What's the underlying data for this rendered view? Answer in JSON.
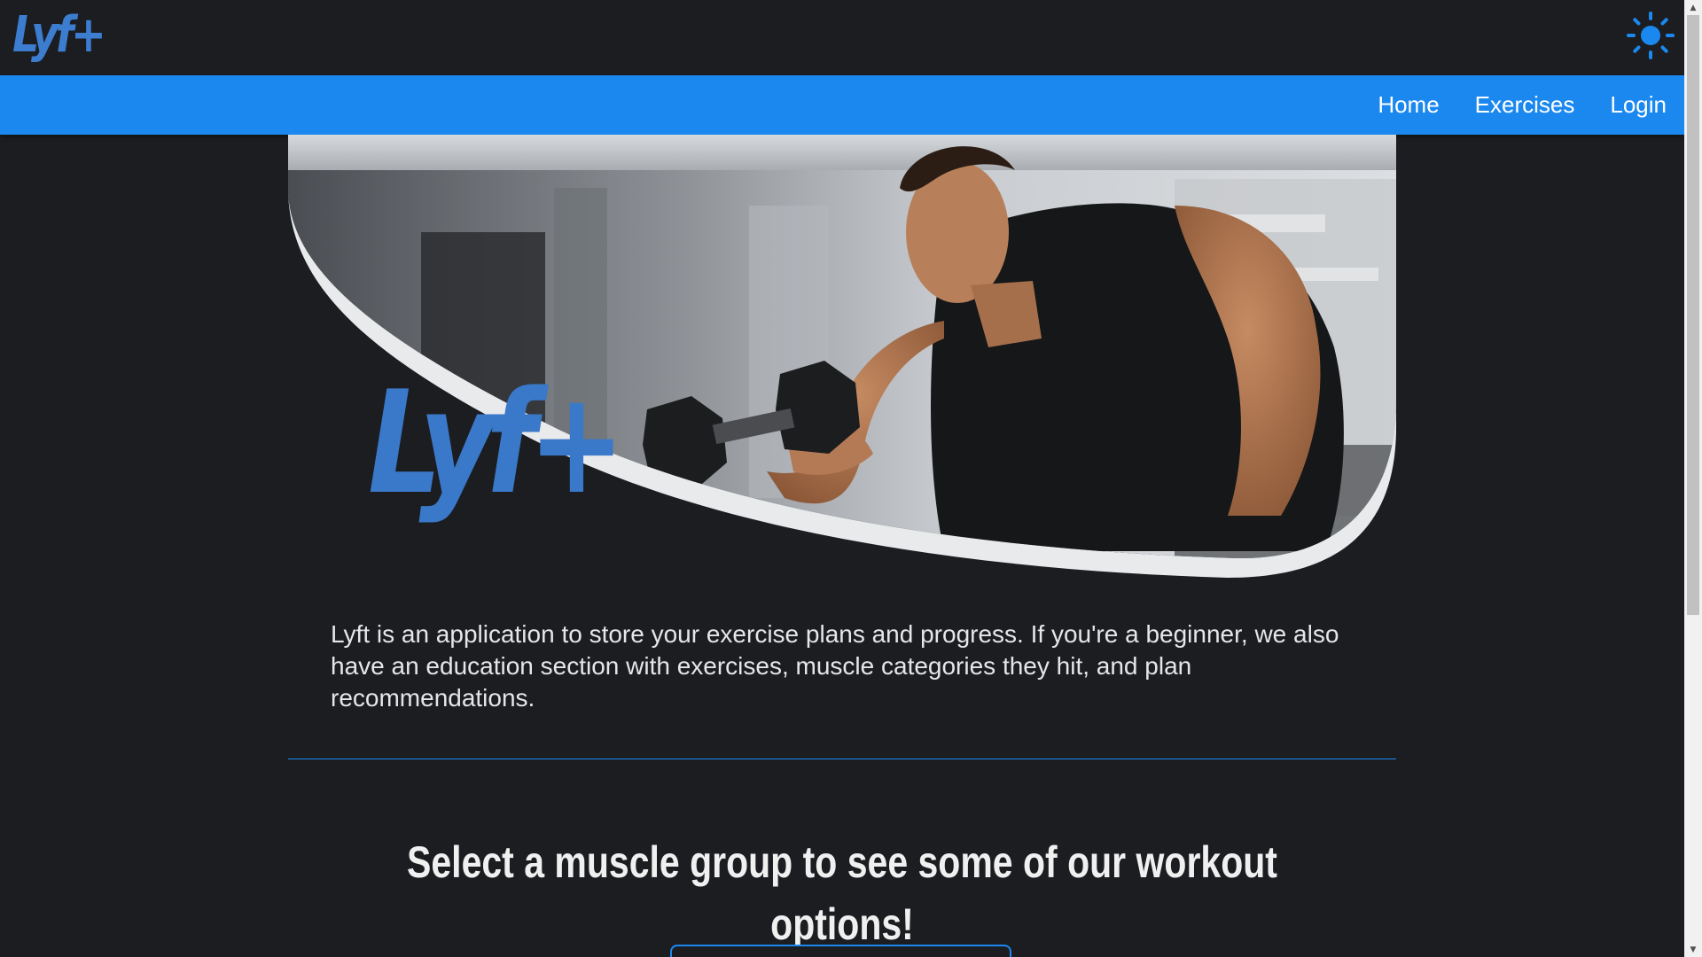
{
  "header": {
    "logo_text": "Lyf+",
    "theme_toggle_icon": "sun-icon"
  },
  "nav": {
    "items": [
      {
        "label": "Home"
      },
      {
        "label": "Exercises"
      },
      {
        "label": "Login"
      }
    ]
  },
  "hero": {
    "logo_text": "Lyf+",
    "image_description_icon": "hero-photo"
  },
  "main": {
    "description": "Lyft is an application to store your exercise plans and progress. If you're a beginner, we also have an education section with exercises, muscle categories they hit, and plan recommendations.",
    "section_heading": "Select a muscle group to see some of our workout options!"
  },
  "colors": {
    "background": "#1b1d21",
    "nav_blue": "#1b88f0",
    "logo_blue": "#3a78c9",
    "text": "#e4e6ea"
  }
}
